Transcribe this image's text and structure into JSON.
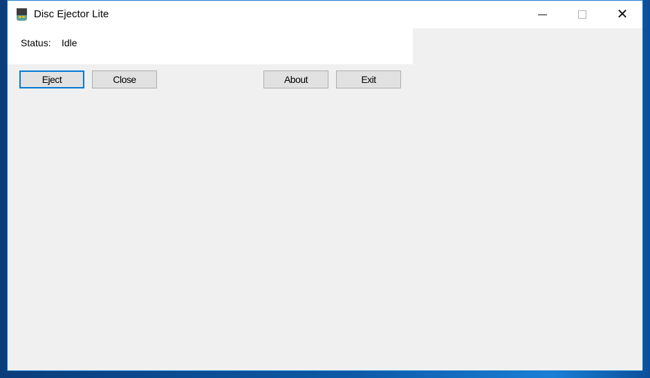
{
  "window": {
    "title": "Disc Ejector Lite",
    "app_icon": "disc-ejector-icon",
    "caption_buttons": {
      "minimize": "minimize-icon",
      "maximize": "maximize-icon",
      "close": "close-icon",
      "close_glyph": "✕"
    }
  },
  "status": {
    "label": "Status:",
    "value": "Idle"
  },
  "buttons": {
    "eject": "Eject",
    "close": "Close",
    "about": "About",
    "exit": "Exit"
  },
  "colors": {
    "accent": "#0078d7",
    "window_bg": "#f0f0f0",
    "button_bg": "#e1e1e1"
  }
}
